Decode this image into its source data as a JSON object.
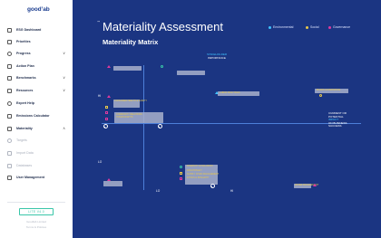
{
  "app": {
    "logo": "good’ab"
  },
  "sidebar": {
    "items": [
      {
        "label": "ESG Dashboard",
        "icon": "dashboard-icon"
      },
      {
        "label": "Priorities",
        "icon": "flag-icon"
      },
      {
        "label": "Progress",
        "icon": "heart-icon",
        "chevron": "∨"
      },
      {
        "label": "Action Plan",
        "icon": "plan-icon"
      },
      {
        "label": "Benchmarks",
        "icon": "chart-icon",
        "chevron": "∨"
      },
      {
        "label": "Resources",
        "icon": "resources-icon",
        "chevron": "∨"
      },
      {
        "label": "Expert Help",
        "icon": "help-icon"
      },
      {
        "label": "Emissions Calculator",
        "icon": "calculator-icon"
      },
      {
        "label": "Materiality",
        "icon": "materiality-icon",
        "chevron": "∧"
      },
      {
        "label": "Targets",
        "icon": "target-icon"
      },
      {
        "label": "Import Data",
        "icon": "import-icon"
      },
      {
        "label": "Databases",
        "icon": "database-icon"
      },
      {
        "label": "User Management",
        "icon": "users-icon"
      }
    ],
    "version": "LITE V4.0",
    "footer_lines": [
      "Goodlab Limited",
      "Terms & Policies"
    ]
  },
  "main": {
    "tm": "™",
    "title": "Materiality Assessment",
    "subtitle": "Materiality Matrix",
    "legend": [
      {
        "label": "Environmental",
        "color": "#3ec2ff"
      },
      {
        "label": "Social",
        "color": "#e8c84a"
      },
      {
        "label": "Governance",
        "color": "#e0399e"
      }
    ],
    "axes": {
      "y_line1": "STAKEHOLDER",
      "y_line2": "IMPORTANCE",
      "x_line1": "CURRENT OR",
      "x_line2": "POTENTIAL",
      "x_line3": "IMPACT",
      "x_line4": "ON BUSINESS",
      "x_line5": "SUCCESS",
      "hi_left": "HI",
      "lo_left": "LO",
      "lo_bottom": "LO",
      "hi_bottom": "HI"
    },
    "points": [
      {
        "label": "CONSUMER HEALTH & SAFETY"
      },
      {
        "label": "COMMUNITY RELATIONS"
      },
      {
        "label": "HUMAN RIGHTS"
      },
      {
        "label": "LABOR PRACTICES"
      },
      {
        "label": "BOARD GOVERNANCE"
      },
      {
        "label": "DIVERSITY & INCLUSION"
      },
      {
        "label": "DATA PRIVACY"
      },
      {
        "label": "SUPPLY CHAIN MANAGEMENT"
      },
      {
        "label": "ETHICS & INTEGRITY"
      },
      {
        "label": "WATER MANAGEMENT"
      }
    ]
  }
}
